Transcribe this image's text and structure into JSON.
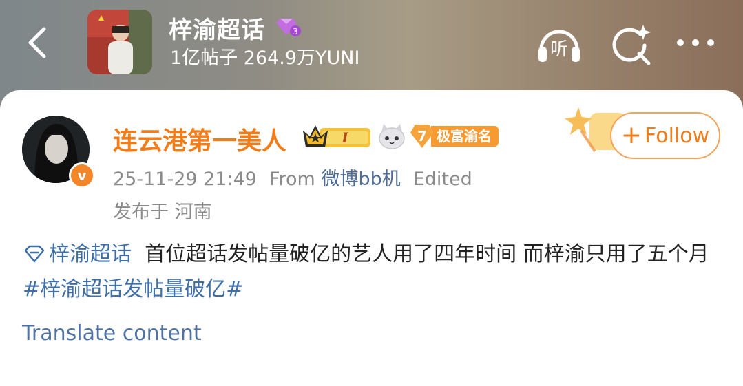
{
  "header": {
    "title": "梓渝超话",
    "level_badge": "3",
    "stats": "1亿帖子 264.9万YUNI",
    "icons": [
      "back-arrow-icon",
      "listen-icon",
      "search-sparkle-icon",
      "more-dots-icon"
    ],
    "listen_label": "听"
  },
  "post": {
    "author": "连云港第一美人",
    "vip_level": "I",
    "rich_level": "7",
    "rich_label": "极富渝名",
    "follow_label": "Follow",
    "timestamp": "25-11-29 21:49",
    "from_label": "From",
    "source": "微博bb机",
    "edited_label": "Edited",
    "location": "发布于 河南",
    "topic_tag": "梓渝超话",
    "body_text": "首位超话发帖量破亿的艺人用了四年时间 而梓渝只用了五个月",
    "hashtag": "#梓渝超话发帖量破亿#",
    "translate_label": "Translate content"
  },
  "colors": {
    "accent_orange": "#f07c1a",
    "link_blue": "#3f6fa8",
    "gem_purple": "#c26de0"
  }
}
